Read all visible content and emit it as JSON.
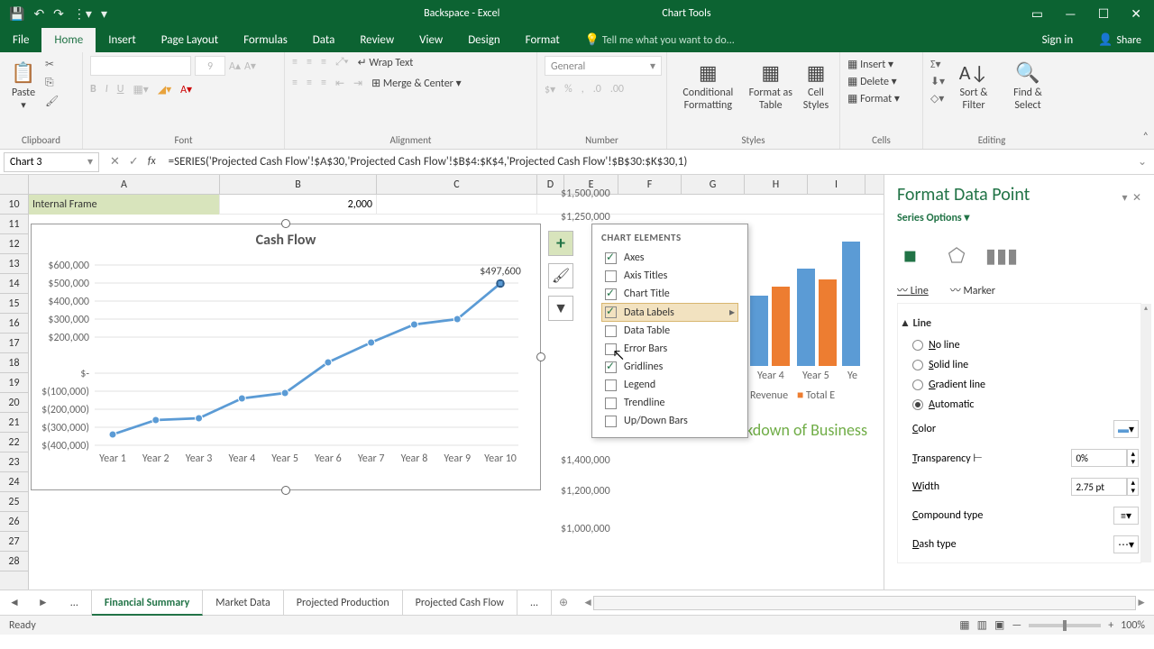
{
  "title": {
    "doc": "Backspace - Excel",
    "context": "Chart Tools"
  },
  "tabs": {
    "file": "File",
    "home": "Home",
    "insert": "Insert",
    "pagelayout": "Page Layout",
    "formulas": "Formulas",
    "data": "Data",
    "review": "Review",
    "view": "View",
    "design": "Design",
    "format": "Format",
    "tellme": "Tell me what you want to do...",
    "signin": "Sign in",
    "share": "Share"
  },
  "ribbon": {
    "clipboard": {
      "label": "Clipboard",
      "paste": "Paste"
    },
    "font": {
      "label": "Font",
      "size": "9"
    },
    "alignment": {
      "label": "Alignment",
      "wrap": "Wrap Text",
      "merge": "Merge & Center"
    },
    "number": {
      "label": "Number",
      "general": "General"
    },
    "styles": {
      "label": "Styles",
      "cond": "Conditional Formatting",
      "fat": "Format as Table",
      "cell": "Cell Styles"
    },
    "cells": {
      "label": "Cells",
      "insert": "Insert",
      "delete": "Delete",
      "format": "Format"
    },
    "editing": {
      "label": "Editing",
      "sort": "Sort & Filter",
      "find": "Find & Select"
    }
  },
  "namebox": "Chart 3",
  "formula": "=SERIES('Projected Cash Flow'!$A$30,'Projected Cash Flow'!$B$4:$K$4,'Projected Cash Flow'!$B$30:$K$30,1)",
  "cols": [
    "A",
    "B",
    "C",
    "D",
    "E",
    "F",
    "G",
    "H",
    "I"
  ],
  "rows": [
    "10",
    "11",
    "12",
    "13",
    "14",
    "15",
    "16",
    "17",
    "18",
    "19",
    "20",
    "21",
    "22",
    "23",
    "24",
    "25",
    "26",
    "27",
    "28"
  ],
  "cellA10": "Internal Frame",
  "cellB10": "2,000",
  "chart": {
    "title": "Cash Flow",
    "last_label": "$497,600"
  },
  "chart_data": {
    "type": "line",
    "title": "Cash Flow",
    "categories": [
      "Year 1",
      "Year 2",
      "Year 3",
      "Year 4",
      "Year 5",
      "Year 6",
      "Year 7",
      "Year 8",
      "Year 9",
      "Year 10"
    ],
    "values": [
      -340000,
      -260000,
      -250000,
      -140000,
      -110000,
      60000,
      170000,
      270000,
      300000,
      497600
    ],
    "y_ticks": [
      "$600,000",
      "$500,000",
      "$400,000",
      "$300,000",
      "$200,000",
      "$-",
      "$(100,000)",
      "$(200,000)",
      "$(300,000)",
      "$(400,000)"
    ],
    "ylim": [
      -400000,
      600000
    ],
    "data_label_last": "$497,600"
  },
  "bar_chart": {
    "type": "bar",
    "categories": [
      "Year 4",
      "Year 5",
      "Ye"
    ],
    "series": [
      {
        "name": "Revenue",
        "color": "#5b9bd5"
      },
      {
        "name": "Total E",
        "color": "#ed7d31"
      }
    ],
    "y_ticks": [
      "$1,500,000",
      "$1,250,000"
    ],
    "partial_heading": "Breakdown of Business",
    "other_ticks": [
      "$1,400,000",
      "$1,200,000",
      "$1,000,000"
    ]
  },
  "chart_elements": {
    "title": "CHART ELEMENTS",
    "items": [
      {
        "label": "Axes",
        "checked": true
      },
      {
        "label": "Axis Titles",
        "checked": false
      },
      {
        "label": "Chart Title",
        "checked": true
      },
      {
        "label": "Data Labels",
        "checked": true,
        "hover": true,
        "arrow": true
      },
      {
        "label": "Data Table",
        "checked": false
      },
      {
        "label": "Error Bars",
        "checked": false
      },
      {
        "label": "Gridlines",
        "checked": true
      },
      {
        "label": "Legend",
        "checked": false
      },
      {
        "label": "Trendline",
        "checked": false
      },
      {
        "label": "Up/Down Bars",
        "checked": false
      }
    ]
  },
  "pane": {
    "title": "Format Data Point",
    "subtitle": "Series Options",
    "tabs": {
      "line": "Line",
      "marker": "Marker"
    },
    "section": "Line",
    "radios": [
      {
        "label": "No line",
        "on": false,
        "u": "N"
      },
      {
        "label": "Solid line",
        "on": false,
        "u": "S"
      },
      {
        "label": "Gradient line",
        "on": false,
        "u": "G"
      },
      {
        "label": "Automatic",
        "on": true,
        "u": "A"
      }
    ],
    "color": "Color",
    "transparency": {
      "label": "Transparency",
      "value": "0%"
    },
    "width": {
      "label": "Width",
      "value": "2.75 pt"
    },
    "compound": "Compound type",
    "dash": "Dash type"
  },
  "sheets": {
    "ell": "...",
    "s1": "Financial Summary",
    "s2": "Market Data",
    "s3": "Projected Production",
    "s4": "Projected Cash Flow",
    "more": "..."
  },
  "status": {
    "ready": "Ready",
    "zoom": "100%"
  }
}
